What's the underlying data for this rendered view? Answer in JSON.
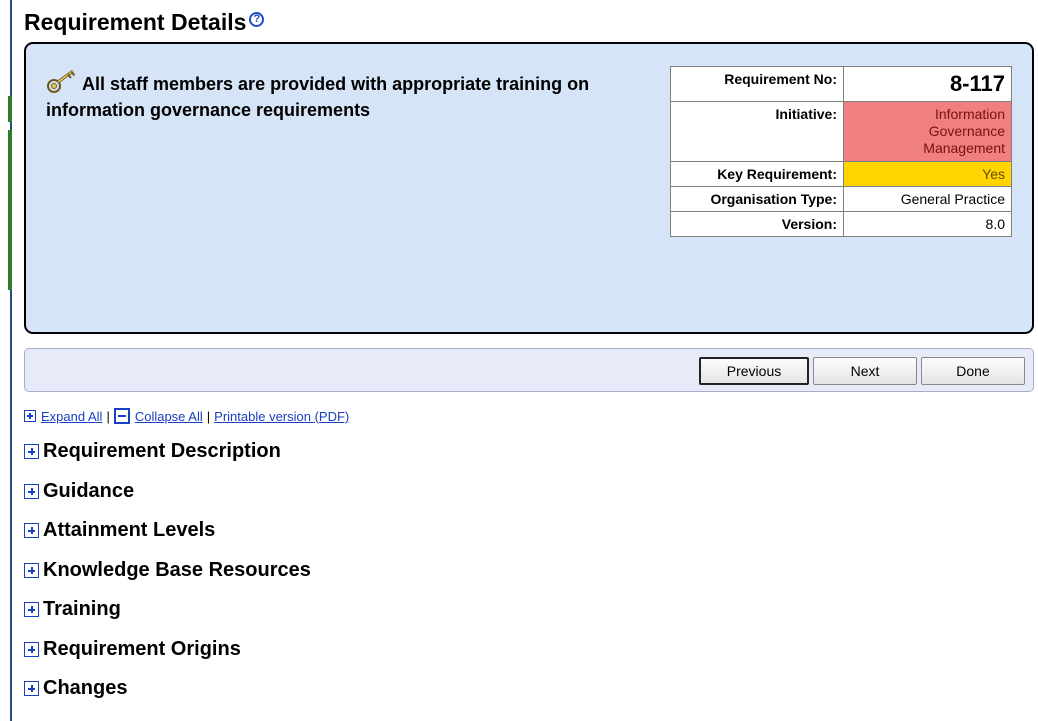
{
  "page": {
    "title": "Requirement Details",
    "help_icon": "question-circle-icon"
  },
  "requirement": {
    "heading": "All staff members are provided with appropriate training on information governance requirements",
    "icon": "key-icon",
    "fields": {
      "requirement_no_label": "Requirement No:",
      "requirement_no": "8-117",
      "initiative_label": "Initiative:",
      "initiative_lines": [
        "Information",
        "Governance",
        "Management"
      ],
      "key_requirement_label": "Key Requirement:",
      "key_requirement": "Yes",
      "organisation_type_label": "Organisation Type:",
      "organisation_type": "General Practice",
      "version_label": "Version:",
      "version": "8.0"
    },
    "colors": {
      "initiative_bg": "#f08080",
      "key_requirement_bg": "#ffd400",
      "panel_bg": "#d6e4f7"
    }
  },
  "nav": {
    "previous": "Previous",
    "next": "Next",
    "done": "Done"
  },
  "links": {
    "expand_all": "Expand All",
    "collapse_all": "Collapse All",
    "printable": "Printable version (PDF)",
    "separator": "|"
  },
  "sections": [
    "Requirement Description",
    "Guidance",
    "Attainment Levels",
    "Knowledge Base Resources",
    "Training",
    "Requirement Origins",
    "Changes"
  ]
}
